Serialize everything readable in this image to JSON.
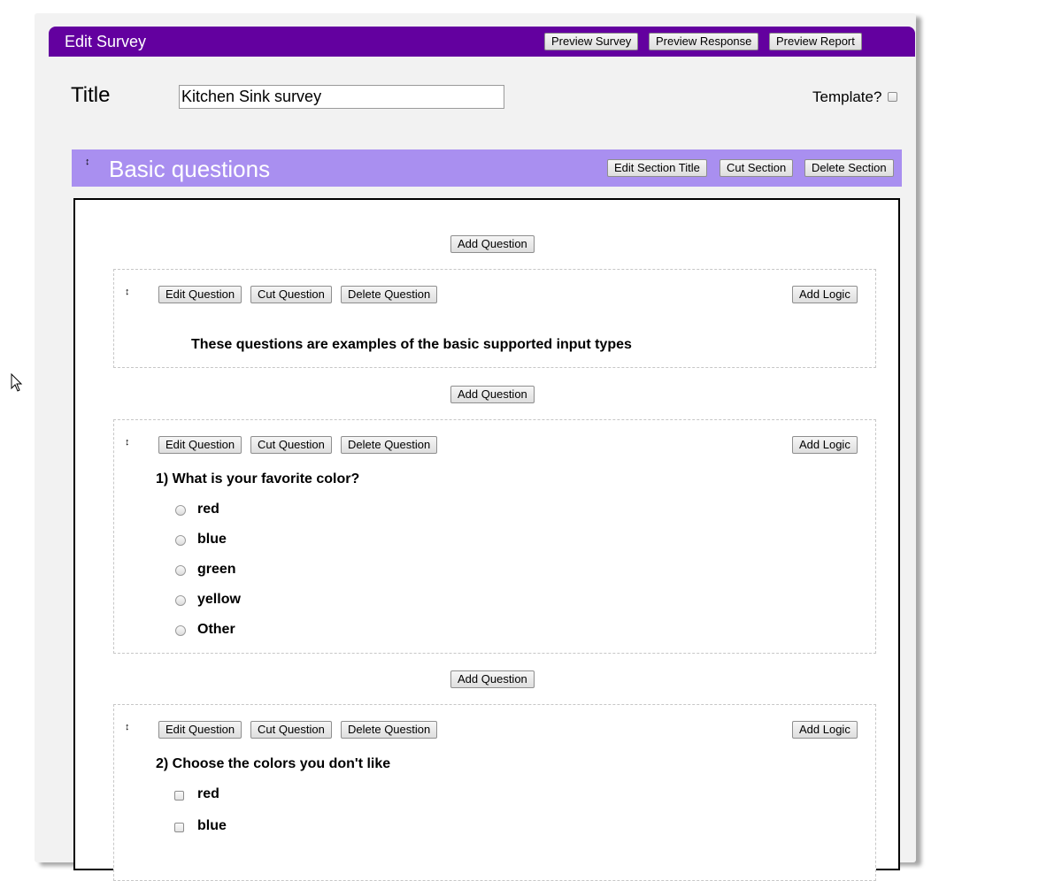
{
  "header": {
    "title": "Edit Survey",
    "preview_survey": "Preview Survey",
    "preview_response": "Preview Response",
    "preview_report": "Preview Report"
  },
  "form": {
    "title_label": "Title",
    "title_value": "Kitchen Sink survey",
    "template_label": "Template?"
  },
  "section": {
    "title": "Basic questions",
    "edit_title": "Edit Section Title",
    "cut": "Cut Section",
    "delete": "Delete Section"
  },
  "labels": {
    "add_question": "Add Question",
    "edit_question": "Edit Question",
    "cut_question": "Cut Question",
    "delete_question": "Delete Question",
    "add_logic": "Add Logic",
    "drag_handle": "↕"
  },
  "questions": [
    {
      "text": "These questions are examples of the basic supported input types"
    },
    {
      "text": "1) What is your favorite color?",
      "options": [
        "red",
        "blue",
        "green",
        "yellow",
        "Other"
      ]
    },
    {
      "text": "2) Choose the colors you don't like",
      "options": [
        "red",
        "blue"
      ]
    }
  ],
  "colors": {
    "header_bg": "#63009f",
    "section_bg": "#a98ff0"
  }
}
